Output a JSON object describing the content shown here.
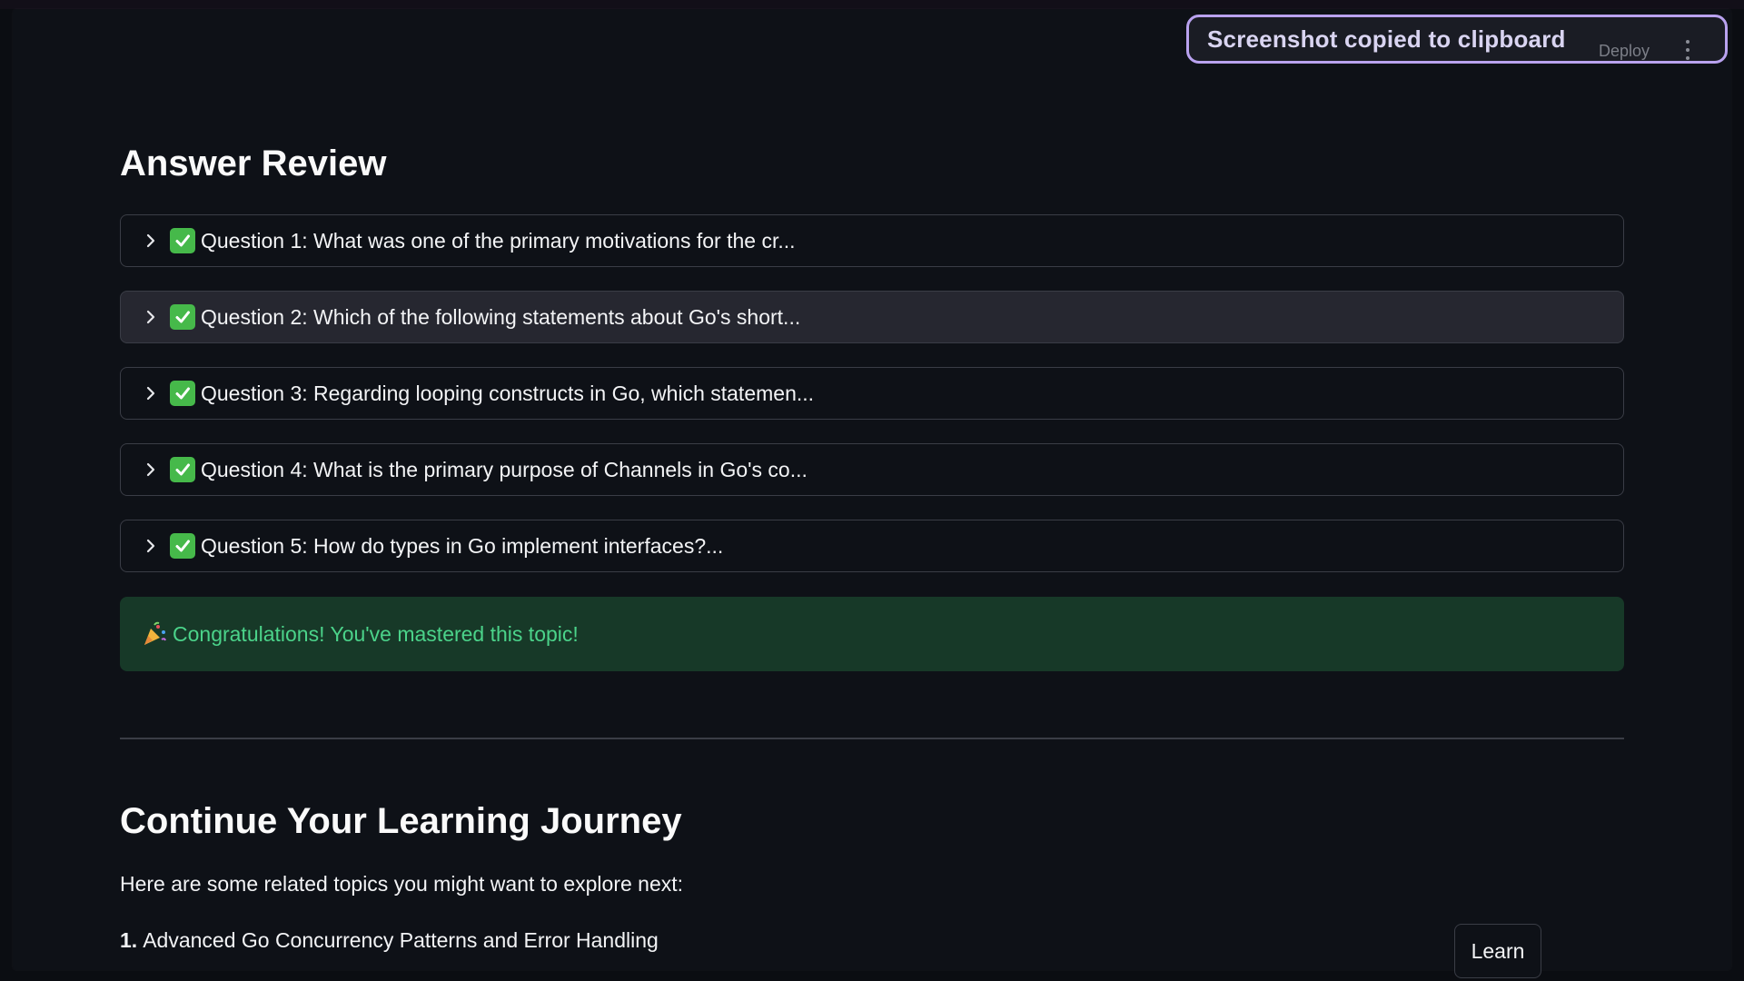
{
  "toast": {
    "message": "Screenshot copied to clipboard"
  },
  "header": {
    "deploy_label": "Deploy",
    "menu_icon": "kebab-menu-icon"
  },
  "answer_review": {
    "title": "Answer Review",
    "questions": [
      {
        "label": "Question 1: What was one of the primary motivations for the cr...",
        "status": "correct"
      },
      {
        "label": "Question 2: Which of the following statements about Go's short...",
        "status": "correct"
      },
      {
        "label": "Question 3: Regarding looping constructs in Go, which statemen...",
        "status": "correct"
      },
      {
        "label": "Question 4: What is the primary purpose of Channels in Go's co...",
        "status": "correct"
      },
      {
        "label": "Question 5: How do types in Go implement interfaces?...",
        "status": "correct"
      }
    ],
    "success_message": "Congratulations! You've mastered this topic!",
    "success_icon": "party-popper-icon"
  },
  "journey": {
    "title": "Continue Your Learning Journey",
    "intro": "Here are some related topics you might want to explore next:",
    "topics": [
      {
        "number": "1.",
        "label": "Advanced Go Concurrency Patterns and Error Handling",
        "button_label": "Learn"
      }
    ]
  },
  "colors": {
    "background": "#0e1117",
    "toast_border": "#b9a2ef",
    "success_bg": "#173928",
    "success_text": "#4bd38a",
    "check_green": "#46b94a"
  }
}
